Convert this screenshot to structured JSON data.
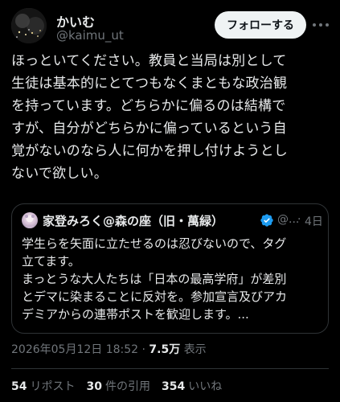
{
  "author": {
    "display_name": "かいむ",
    "handle": "@kaimu_ut",
    "avatar_icon": "avatar-night-cityscape"
  },
  "follow_button": {
    "label": "フォローする"
  },
  "more_icon": "more-horizontal-icon",
  "tweet": {
    "text": "ほっといてください。教員と当局は別として\n生徒は基本的にとてつもなくまともな政治観\nを持っています。どちらかに偏るのは結構で\nすが、自分がどちらかに偏っているという自\n覚がないのなら人に何かを押し付けようとし\nないで欲しい。"
  },
  "quote": {
    "display_name": "家登みろく@森の座（旧・萬緑）",
    "verified_icon": "verified-badge-icon",
    "handle": "@...",
    "separator": "·",
    "date": "4日",
    "text": "学生らを矢面に立たせるのは忍びないので、タグ\n立てます。\nまっとうな大人たちは「日本の最高学府」が差別\nとデマに染まることに反対を。参加宣言及びアカ\nデミアからの連帯ポストを歓迎します。..."
  },
  "meta": {
    "timestamp": "2026年05月12日 18:52",
    "separator": "·",
    "views_count": "7.5万",
    "views_label": "表示"
  },
  "stats": {
    "reposts_count": "54",
    "reposts_label": "リポスト",
    "quotes_count": "30",
    "quotes_label": "件の引用",
    "likes_count": "354",
    "likes_label": "いいね"
  },
  "colors": {
    "background": "#000000",
    "text_primary": "#e7e9ea",
    "text_secondary": "#71767b",
    "border": "#2f3336",
    "verified": "#1d9bf0",
    "follow_bg": "#eff3f4"
  }
}
